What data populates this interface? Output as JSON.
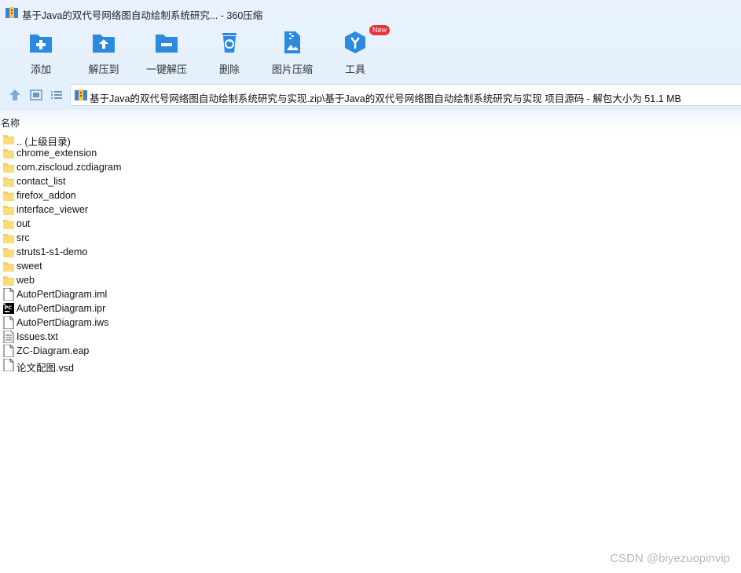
{
  "window": {
    "title": "基于Java的双代号网络图自动绘制系统研究... - 360压缩"
  },
  "toolbar": {
    "buttons": [
      {
        "label": "添加",
        "icon": "add-folder-icon"
      },
      {
        "label": "解压到",
        "icon": "extract-to-icon"
      },
      {
        "label": "一键解压",
        "icon": "one-click-extract-icon"
      },
      {
        "label": "删除",
        "icon": "delete-bin-icon"
      },
      {
        "label": "图片压缩",
        "icon": "image-compress-icon"
      },
      {
        "label": "工具",
        "icon": "tools-cube-icon",
        "badge": "New"
      }
    ]
  },
  "navbar": {
    "path": "基于Java的双代号网络图自动绘制系统研究与实现.zip\\基于Java的双代号网络图自动绘制系统研究与实现 项目源码 - 解包大小为 51.1 MB"
  },
  "columns": {
    "name": "名称"
  },
  "files": [
    {
      "name": ".. (上级目录)",
      "type": "folder"
    },
    {
      "name": "chrome_extension",
      "type": "folder"
    },
    {
      "name": "com.ziscloud.zcdiagram",
      "type": "folder"
    },
    {
      "name": "contact_list",
      "type": "folder"
    },
    {
      "name": "firefox_addon",
      "type": "folder"
    },
    {
      "name": "interface_viewer",
      "type": "folder"
    },
    {
      "name": "out",
      "type": "folder"
    },
    {
      "name": "src",
      "type": "folder"
    },
    {
      "name": "struts1-s1-demo",
      "type": "folder"
    },
    {
      "name": "sweet",
      "type": "folder"
    },
    {
      "name": "web",
      "type": "folder"
    },
    {
      "name": "AutoPertDiagram.iml",
      "type": "file"
    },
    {
      "name": "AutoPertDiagram.ipr",
      "type": "pycharm"
    },
    {
      "name": "AutoPertDiagram.iws",
      "type": "file"
    },
    {
      "name": "Issues.txt",
      "type": "text"
    },
    {
      "name": "ZC-Diagram.eap",
      "type": "file"
    },
    {
      "name": "论文配图.vsd",
      "type": "file"
    }
  ],
  "watermark": "CSDN @biyezuopinvip",
  "colors": {
    "accent": "#2b8ae0",
    "folder": "#f7cf5a",
    "badge": "#e8323c"
  }
}
